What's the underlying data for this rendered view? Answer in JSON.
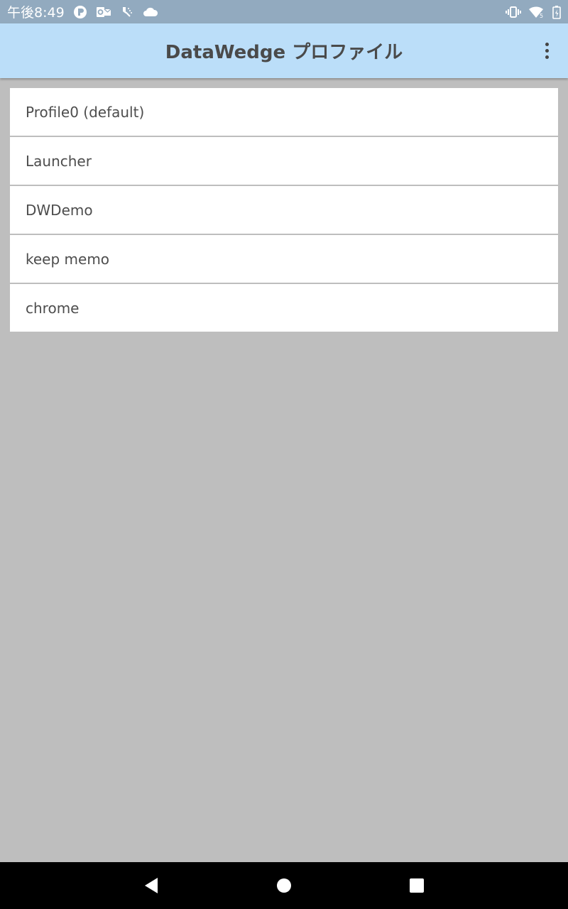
{
  "status_bar": {
    "time": "午後8:49",
    "left_icons": [
      "app-icon",
      "outlook-icon",
      "scanner-icon",
      "cloud-icon"
    ],
    "right_icons": [
      "vibrate-icon",
      "wifi-icon",
      "battery-charging-icon"
    ]
  },
  "app_bar": {
    "title": "DataWedge プロファイル",
    "menu_icon": "overflow-menu-icon"
  },
  "profiles": [
    {
      "label": "Profile0 (default)"
    },
    {
      "label": "Launcher"
    },
    {
      "label": "DWDemo"
    },
    {
      "label": "keep memo"
    },
    {
      "label": "chrome"
    }
  ],
  "nav_bar": {
    "buttons": [
      "back-icon",
      "home-icon",
      "recents-icon"
    ]
  },
  "colors": {
    "status_bar": "#92aabf",
    "app_bar": "#bbdef9",
    "background": "#bebebe",
    "list_item": "#ffffff",
    "nav_bar": "#000000"
  }
}
